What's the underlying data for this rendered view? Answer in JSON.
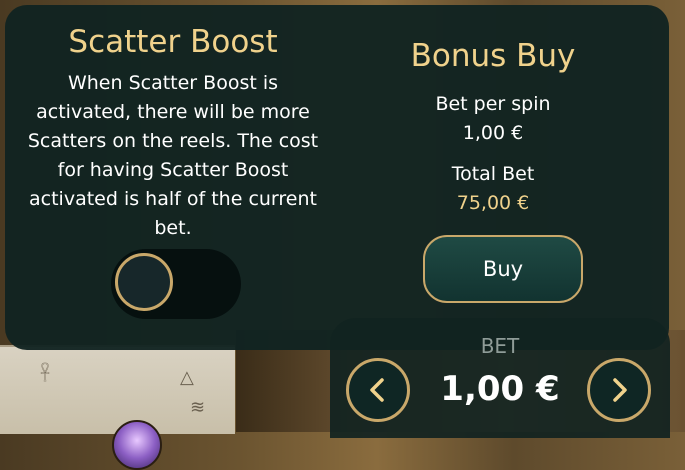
{
  "scatter_boost": {
    "title": "Scatter Boost",
    "description": "When Scatter Boost is activated, there will be more Scatters on the reels. The cost for having Scatter Boost activated is half of the current bet.",
    "toggle_on": false
  },
  "bonus_buy": {
    "title": "Bonus Buy",
    "bet_per_spin_label": "Bet per spin",
    "bet_per_spin_value": "1,00 €",
    "total_bet_label": "Total Bet",
    "total_bet_value": "75,00 €",
    "buy_label": "Buy"
  },
  "bet": {
    "label": "BET",
    "value": "1,00 €",
    "decrease_icon": "chevron-left-icon",
    "increase_icon": "chevron-right-icon"
  },
  "colors": {
    "accent_gold": "#f0d28c",
    "panel": "#112321",
    "border_gold": "#c9a86a"
  }
}
